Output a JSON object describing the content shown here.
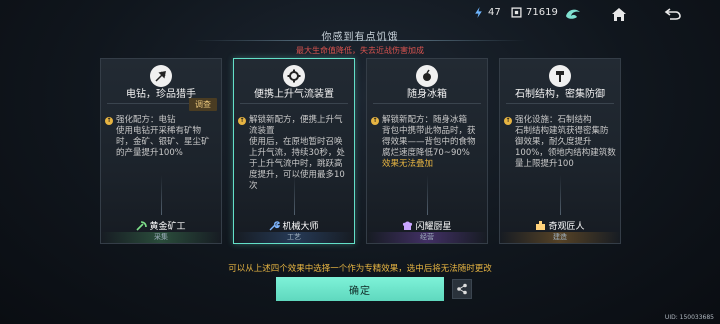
{
  "topbar": {
    "energy": "47",
    "coins": "71619",
    "icons": [
      "lightning-icon",
      "coin-icon",
      "swirl-icon",
      "home-icon",
      "back-icon"
    ]
  },
  "banner": {
    "title": "你感到有点饥饿",
    "subtitle": "最大生命值降低，失去近战伤害加成"
  },
  "cards": [
    {
      "title": "电钻，珍品猎手",
      "tag": "调查",
      "lines": [
        {
          "kind": "bullet",
          "text": "强化配方：电钻"
        },
        {
          "kind": "indent",
          "text": "使用电钻开采稀有矿物时，金矿、银矿、星尘矿的产量提升100%"
        }
      ],
      "role": "黄金矿工",
      "footer": "采集"
    },
    {
      "title": "便携上升气流装置",
      "tag": "",
      "lines": [
        {
          "kind": "bullet",
          "text": "解锁新配方，便携上升气流装置"
        },
        {
          "kind": "indent",
          "text": "使用后，在原地暂时召唤上升气流，持续30秒，处于上升气流中时，跳跃高度提升，可以使用最多10次"
        }
      ],
      "role": "机械大师",
      "footer": "工艺"
    },
    {
      "title": "随身冰箱",
      "tag": "",
      "lines": [
        {
          "kind": "bullet",
          "text": "解锁新配方：随身冰箱"
        },
        {
          "kind": "indent",
          "text": "背包中携带此物品时，获得效果——背包中的食物腐烂速度降低70~90%"
        },
        {
          "kind": "highlight",
          "text": "效果无法叠加"
        }
      ],
      "role": "闪耀厨星",
      "footer": "经营"
    },
    {
      "title": "石制结构，密集防御",
      "tag": "",
      "lines": [
        {
          "kind": "bullet",
          "text": "强化设施：石制结构"
        },
        {
          "kind": "indent",
          "text": "石制结构建筑获得密集防御效果，耐久度提升100%，领地内结构建筑数量上限提升100"
        }
      ],
      "role": "奇观匠人",
      "footer": "建造"
    }
  ],
  "hint": "可以从上述四个效果中选择一个作为专精效果，选中后将无法随时更改",
  "confirm_label": "确定",
  "uid": "UID: 150033685",
  "colors": {
    "accent": "#63e0c8",
    "warning": "#e6b442",
    "danger": "#d9534f"
  }
}
